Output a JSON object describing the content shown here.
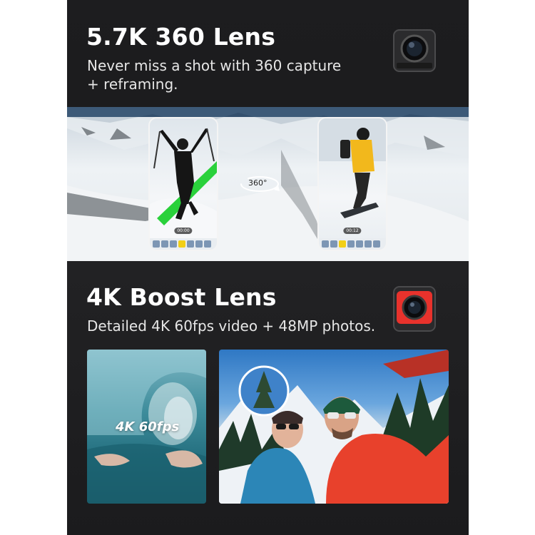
{
  "section1": {
    "title": "5.7K 360 Lens",
    "subtitle_line1": "Never miss a shot with 360 capture",
    "subtitle_line2": "+ reframing.",
    "rotate_label": "360°",
    "left_timestamp": "00:00",
    "right_timestamp": "00:12",
    "camera_icon": "camera-360-lens-icon"
  },
  "section2": {
    "title": "4K Boost Lens",
    "subtitle": "Detailed 4K 60fps video + 48MP photos.",
    "wave_label": "4K 60fps",
    "camera_icon": "camera-4k-lens-icon"
  },
  "colors": {
    "background": "#1d1d1f",
    "text": "#ffffff",
    "accent_green": "#2ad13b",
    "accent_red": "#e8322c"
  }
}
